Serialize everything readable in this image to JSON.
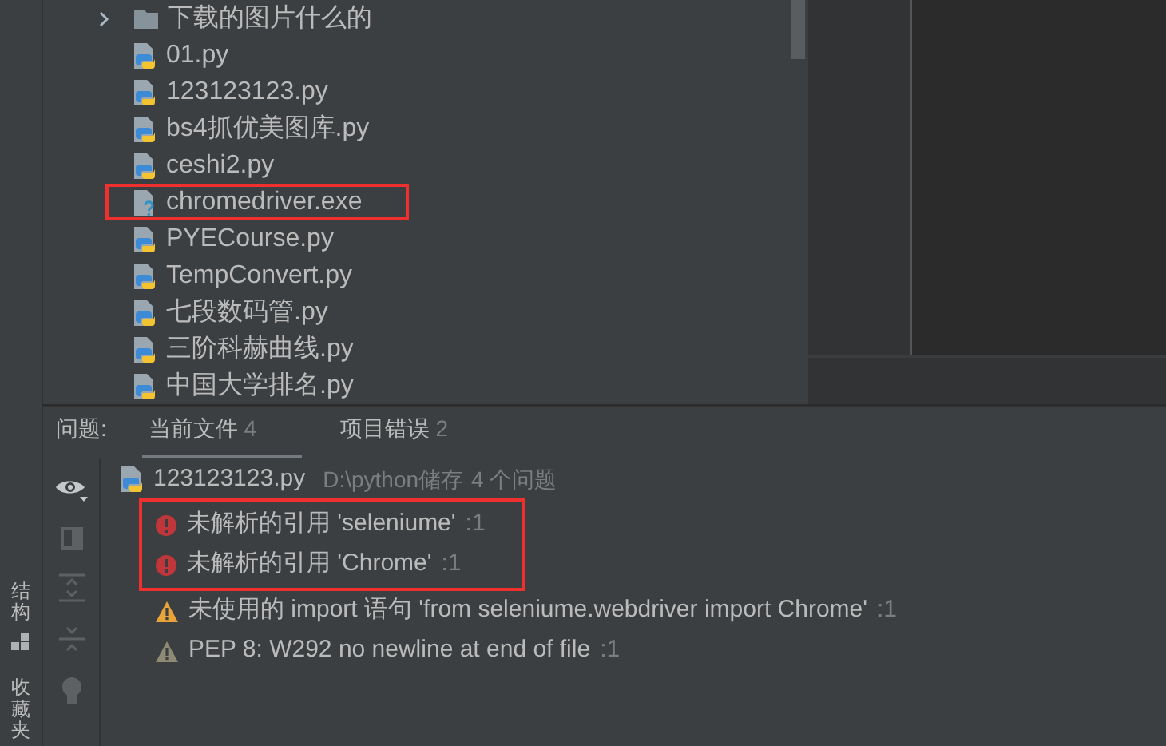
{
  "sidebar": {
    "labels": [
      "结构",
      "收藏夹"
    ]
  },
  "tree": {
    "items": [
      {
        "name": "下载的图片什么的",
        "kind": "folder",
        "expanded": false,
        "highlighted": false
      },
      {
        "name": "01.py",
        "kind": "python",
        "highlighted": false
      },
      {
        "name": "123123123.py",
        "kind": "python",
        "highlighted": false
      },
      {
        "name": "bs4抓优美图库.py",
        "kind": "python",
        "highlighted": false
      },
      {
        "name": "ceshi2.py",
        "kind": "python",
        "highlighted": false
      },
      {
        "name": "chromedriver.exe",
        "kind": "unknown",
        "highlighted": true
      },
      {
        "name": "PYECourse.py",
        "kind": "python",
        "highlighted": false
      },
      {
        "name": "TempConvert.py",
        "kind": "python",
        "highlighted": false
      },
      {
        "name": "七段数码管.py",
        "kind": "python",
        "highlighted": false
      },
      {
        "name": "三阶科赫曲线.py",
        "kind": "python",
        "highlighted": false
      },
      {
        "name": "中国大学排名.py",
        "kind": "python",
        "highlighted": false
      }
    ]
  },
  "problems": {
    "label": "问题:",
    "tabs": [
      {
        "label": "当前文件",
        "count": "4",
        "selected": true
      },
      {
        "label": "项目错误",
        "count": "2",
        "selected": false
      }
    ],
    "file": {
      "name": "123123123.py",
      "path": "D:\\python储存",
      "summary": "4 个问题"
    },
    "issues": [
      {
        "kind": "error",
        "message": "未解析的引用 'seleniume'",
        "line": ":1",
        "highlighted": true
      },
      {
        "kind": "error",
        "message": "未解析的引用 'Chrome'",
        "line": ":1",
        "highlighted": true
      },
      {
        "kind": "warning",
        "message": "未使用的 import 语句 'from seleniume.webdriver import Chrome'",
        "line": ":1",
        "highlighted": false
      },
      {
        "kind": "weak_warning",
        "message": "PEP 8: W292 no newline at end of file",
        "line": ":1",
        "highlighted": false
      }
    ]
  }
}
